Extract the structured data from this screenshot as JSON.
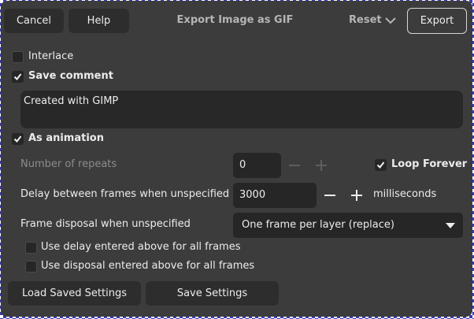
{
  "header": {
    "cancel_label": "Cancel",
    "help_label": "Help",
    "title": "Export Image as GIF",
    "reset_label": "Reset",
    "export_label": "Export"
  },
  "options": {
    "interlace": {
      "label": "Interlace",
      "checked": false
    },
    "save_comment": {
      "label": "Save comment",
      "checked": true
    },
    "comment_text": "Created with GIMP",
    "as_animation": {
      "label": "As animation",
      "checked": true
    }
  },
  "animation": {
    "repeats_label": "Number of repeats",
    "repeats_value": "0",
    "loop_forever": {
      "label": "Loop Forever",
      "checked": true
    },
    "delay_label": "Delay between frames when unspecified",
    "delay_value": "3000",
    "delay_unit": "milliseconds",
    "disposal_label": "Frame disposal when unspecified",
    "disposal_selected": "One frame per layer (replace)",
    "use_delay": {
      "label": "Use delay entered above for all frames",
      "checked": false
    },
    "use_disposal": {
      "label": "Use disposal entered above for all frames",
      "checked": false
    }
  },
  "footer": {
    "load_label": "Load Saved Settings",
    "save_label": "Save Settings"
  },
  "icons": {
    "check": "check-icon",
    "minus": "minus-icon",
    "plus": "plus-icon",
    "chevron": "chevron-down-icon"
  },
  "colors": {
    "dialog_bg": "#3c3c3c",
    "field_bg": "#262626",
    "text": "#ececec",
    "dim_text": "#8c8c8c"
  }
}
